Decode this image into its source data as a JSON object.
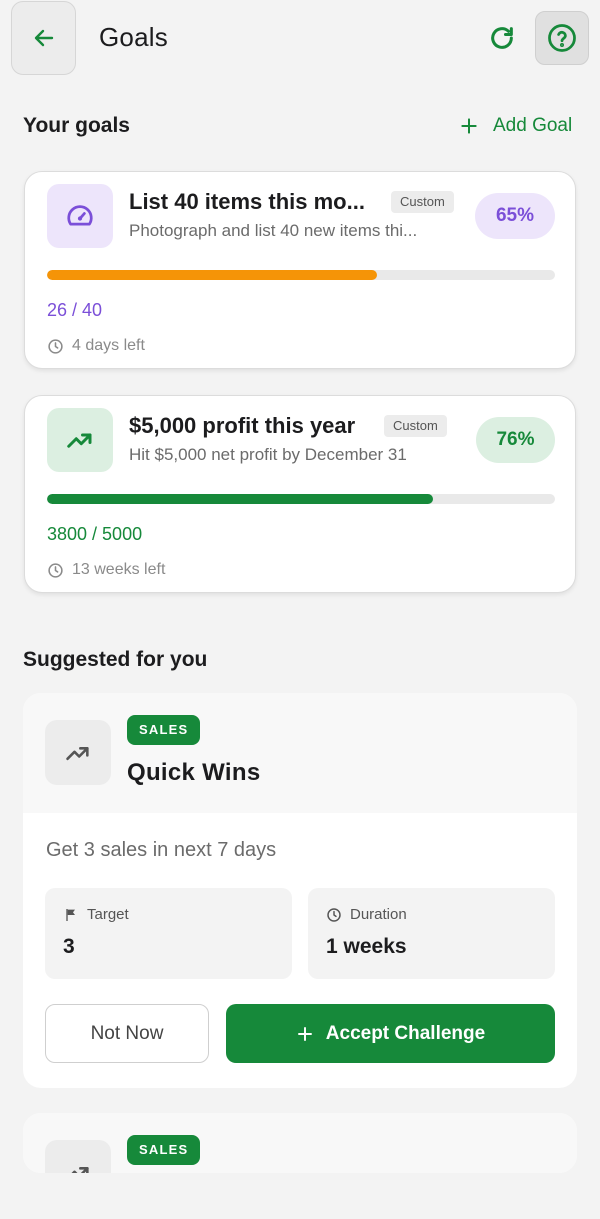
{
  "header": {
    "title": "Goals",
    "back_icon": "arrow-left-icon",
    "refresh_icon": "refresh-icon",
    "help_icon": "help-circle-icon"
  },
  "goals_section": {
    "title": "Your goals",
    "add_label": "Add Goal"
  },
  "goals": [
    {
      "title": "List 40 items this mo...",
      "tag": "Custom",
      "subtitle": "Photograph and list 40 new items thi...",
      "percent_label": "65%",
      "progress": 0.65,
      "progress_text": "26 / 40",
      "time_left": "4 days left",
      "icon": "speedometer-icon",
      "accent": "#7b4fd8",
      "bar_color": "#f59407",
      "icon_bg": "#ede5fb"
    },
    {
      "title": "$5,000 profit this year",
      "tag": "Custom",
      "subtitle": "Hit $5,000 net profit by December 31",
      "percent_label": "76%",
      "progress": 0.76,
      "progress_text": "3800 / 5000",
      "time_left": "13 weeks left",
      "icon": "trending-up-icon",
      "accent": "#16893a",
      "bar_color": "#16893a",
      "icon_bg": "#dcefe1"
    }
  ],
  "suggested_section": {
    "title": "Suggested for you"
  },
  "suggestions": [
    {
      "badge": "SALES",
      "title": "Quick Wins",
      "description": "Get 3 sales in next 7 days",
      "icon": "trending-up-icon",
      "target_label": "Target",
      "target_value": "3",
      "duration_label": "Duration",
      "duration_value": "1 weeks",
      "not_now_label": "Not Now",
      "accept_label": "Accept Challenge"
    },
    {
      "badge": "SALES",
      "icon": "trending-up-icon"
    }
  ],
  "colors": {
    "brand_green": "#16893a",
    "purple": "#7b4fd8",
    "orange": "#f59407"
  }
}
